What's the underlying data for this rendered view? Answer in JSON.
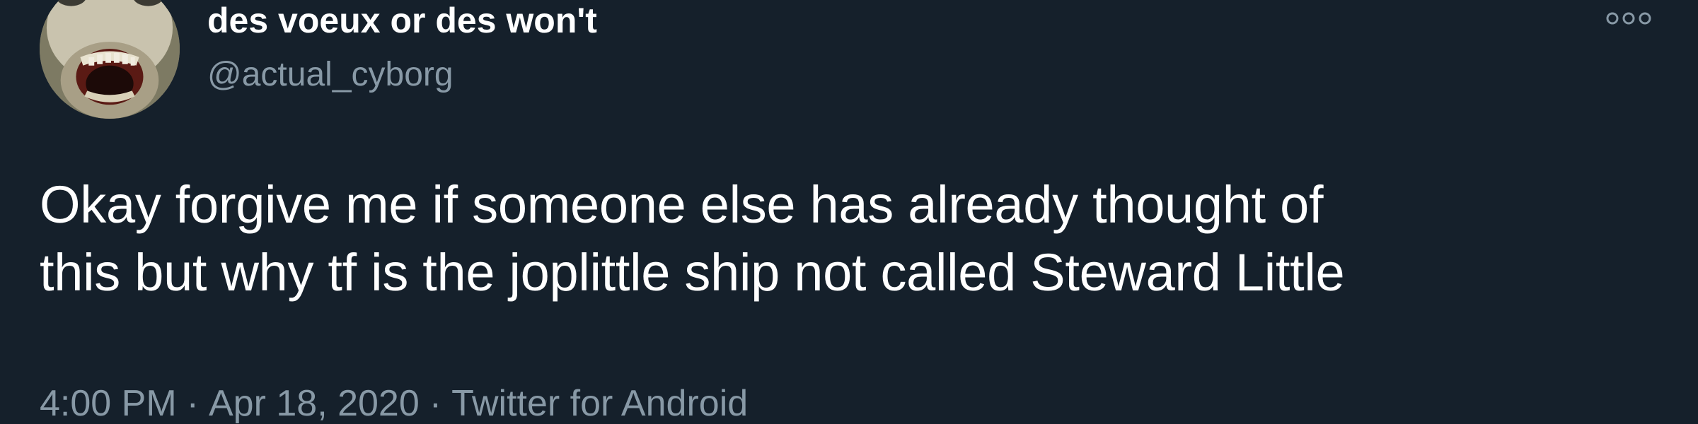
{
  "author": {
    "display_name": "des voeux or des won't",
    "handle": "@actual_cyborg",
    "avatar_icon": "profile-photo"
  },
  "menu": {
    "icon": "more-options-icon"
  },
  "tweet": {
    "text_lines": [
      "Okay forgive me if someone else has already thought of",
      "this but why tf is the joplittle ship not called Steward Little"
    ]
  },
  "meta": {
    "time": "4:00 PM",
    "separator": "·",
    "date": "Apr 18, 2020",
    "source": "Twitter for Android"
  },
  "colors": {
    "background": "#15202b",
    "primary_text": "#ffffff",
    "secondary_text": "#8899a6"
  }
}
